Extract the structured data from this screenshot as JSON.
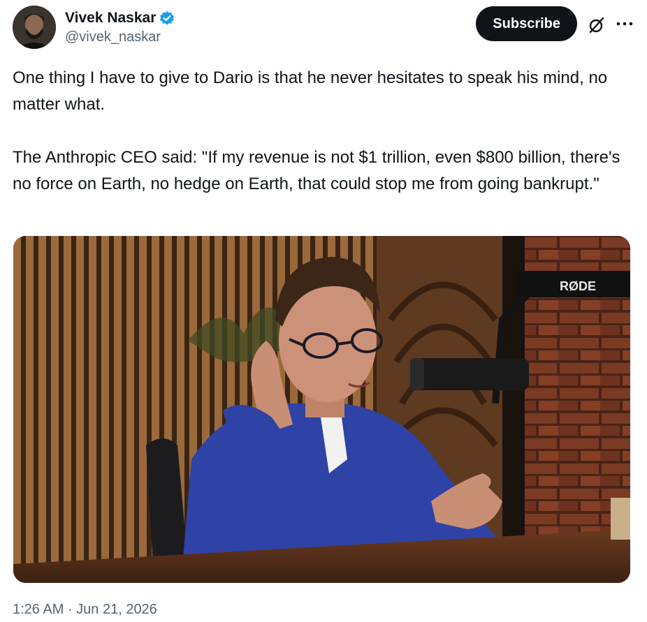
{
  "author": {
    "name": "Vivek Naskar",
    "handle": "@vivek_naskar",
    "verified": true,
    "verified_color": "#1d9bf0"
  },
  "actions": {
    "subscribe_label": "Subscribe",
    "grok_icon": "grok-icon",
    "more_icon": "more-icon"
  },
  "tweet": {
    "paragraphs": [
      "One thing I have to give to Dario is that he never hesitates to speak his mind, no matter what.",
      "The Anthropic CEO said: \"If my revenue is not $1 trillion, even $800 billion, there's no force on Earth, no hedge on Earth, that could stop me from going bankrupt.\""
    ],
    "timestamp": "1:26 AM · Jun 21, 2026"
  },
  "media": {
    "mic_brand": "RØDE"
  },
  "colors": {
    "text": "#0f1419",
    "secondary": "#536471",
    "button_bg": "#0f1419",
    "button_text": "#ffffff"
  }
}
